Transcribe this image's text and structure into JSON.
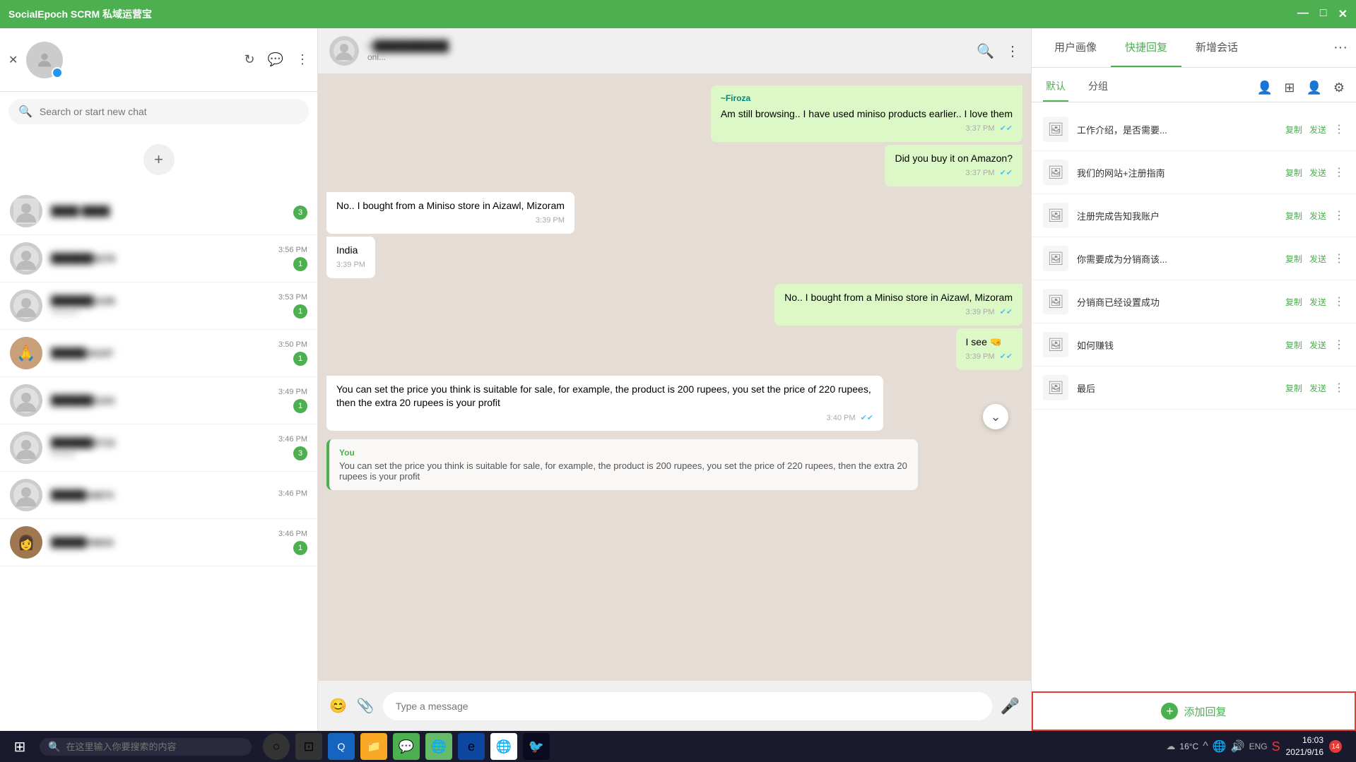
{
  "app": {
    "title": "SocialEpoch SCRM 私域运营宝",
    "controls": [
      "—",
      "□",
      "✕"
    ]
  },
  "sidebar": {
    "search_placeholder": "Search or start new chat",
    "contacts": [
      {
        "id": 1,
        "name": "████ ████",
        "preview": "",
        "time": "",
        "unread": 3,
        "hasImage": true
      },
      {
        "id": 2,
        "name": "██████5278",
        "preview": "",
        "time": "3:56 PM",
        "unread": 1,
        "hasImage": false
      },
      {
        "id": 3,
        "name": "██████2109",
        "preview": "roducts",
        "time": "3:53 PM",
        "unread": 1,
        "hasImage": false
      },
      {
        "id": 4,
        "name": "█████20197",
        "preview": "",
        "time": "3:50 PM",
        "unread": 1,
        "hasImage": true
      },
      {
        "id": 5,
        "name": "██████1104",
        "preview": "",
        "time": "3:49 PM",
        "unread": 1,
        "hasImage": false
      },
      {
        "id": 6,
        "name": "██████3715",
        "preview": "details",
        "time": "3:46 PM",
        "unread": 3,
        "hasImage": false
      },
      {
        "id": 7,
        "name": "█████34874",
        "preview": "",
        "time": "3:46 PM",
        "unread": 0,
        "hasImage": false
      },
      {
        "id": 8,
        "name": "█████94834",
        "preview": "",
        "time": "3:46 PM",
        "unread": 1,
        "hasImage": true
      }
    ]
  },
  "chat": {
    "contact_name": "+██████████",
    "contact_status": "oni...",
    "messages": [
      {
        "id": 1,
        "type": "outgoing",
        "sender": "~Firoza",
        "text": "Am still browsing.. I have used miniso products earlier.. I love them",
        "time": "3:37 PM",
        "ticks": true
      },
      {
        "id": 2,
        "type": "outgoing",
        "sender": null,
        "text": "Did you buy it on Amazon?",
        "time": "3:37 PM",
        "ticks": true
      },
      {
        "id": 3,
        "type": "incoming",
        "sender": null,
        "text": "No.. I bought from a Miniso store in Aizawl, Mizoram",
        "time": "3:39 PM",
        "ticks": false
      },
      {
        "id": 4,
        "type": "incoming",
        "sender": null,
        "text": "India",
        "time": "3:39 PM",
        "ticks": false
      },
      {
        "id": 5,
        "type": "outgoing",
        "sender": null,
        "text": "No.. I bought from a Miniso store in Aizawl, Mizoram",
        "time": "3:39 PM",
        "ticks": true
      },
      {
        "id": 6,
        "type": "outgoing",
        "sender": null,
        "text": "I see 🤜",
        "time": "3:39 PM",
        "ticks": true
      },
      {
        "id": 7,
        "type": "incoming",
        "sender": null,
        "text": "You can set the price you think is suitable for sale, for example, the product is 200 rupees, you set the price of 220 rupees, then the extra 20 rupees is your profit",
        "time": "3:40 PM",
        "ticks": true
      }
    ],
    "preview": {
      "sender": "You",
      "text": "You can set the price you think is suitable for sale, for example, the product is 200 rupees, you set the price of 220 rupees, then the extra 20 rupees is your profit"
    },
    "input_placeholder": "Type a message"
  },
  "right_panel": {
    "tabs": [
      "用户画像",
      "快捷回复",
      "新增会话"
    ],
    "active_tab": "快捷回复",
    "sub_tabs": [
      "默认",
      "分组"
    ],
    "active_sub": "默认",
    "quick_replies": [
      {
        "id": 1,
        "text": "工作介绍，是否需要..."
      },
      {
        "id": 2,
        "text": "我们的网站+注册指南"
      },
      {
        "id": 3,
        "text": "注册完成告知我账户"
      },
      {
        "id": 4,
        "text": "你需要成为分销商该..."
      },
      {
        "id": 5,
        "text": "分销商已经设置成功"
      },
      {
        "id": 6,
        "text": "如何赚钱"
      },
      {
        "id": 7,
        "text": "最后"
      }
    ],
    "action_copy": "复制",
    "action_send": "发送",
    "add_reply_btn": "添加回复",
    "footer_border_color": "#e53935"
  },
  "taskbar": {
    "search_placeholder": "在这里输入你要搜索的内容",
    "time": "16:03",
    "date": "2021/9/16",
    "notification_count": "14",
    "temp": "16°C"
  }
}
